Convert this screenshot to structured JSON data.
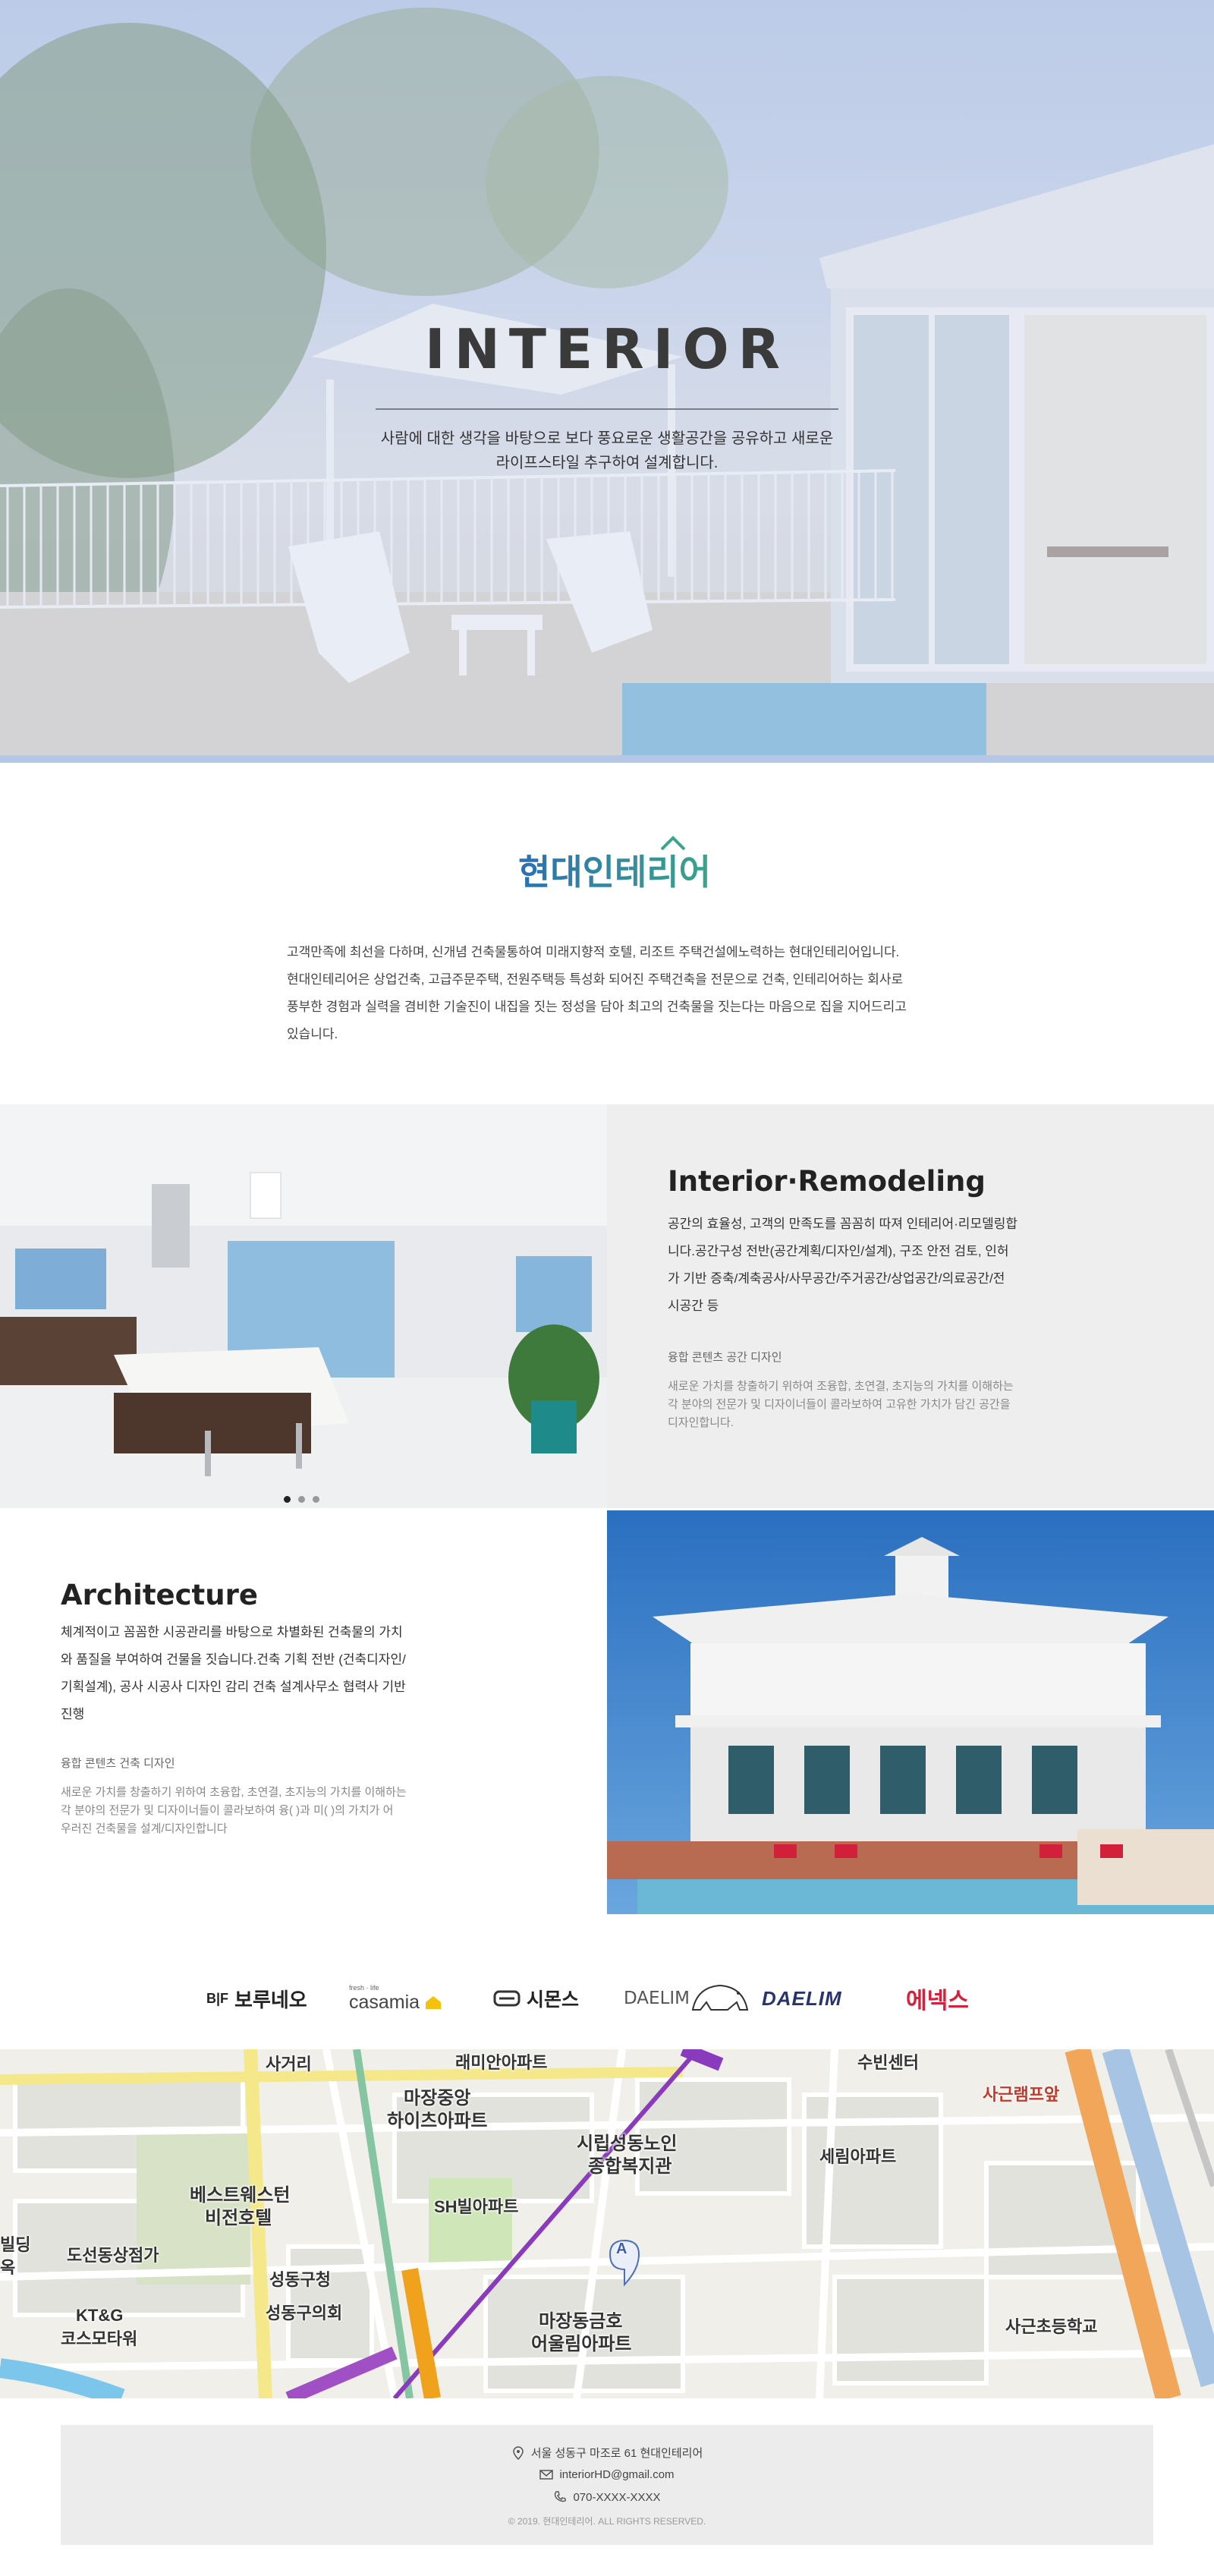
{
  "hero": {
    "title": "INTERIOR",
    "subtitle_line1": "사람에 대한 생각을 바탕으로 보다 풍요로운 생활공간을 공유하고 새로운",
    "subtitle_line2": "라이프스타일 추구하여 설계합니다."
  },
  "brand": {
    "logo_text": "현대인테리어",
    "accent_color": "#2a6fb5",
    "accent_color2": "#3aa58a"
  },
  "intro": {
    "lines": [
      "고객만족에 최선을 다하며, 신개념 건축물통하여 미래지향적 호텔, 리조트 주택건설에노력하는 현대인테리어입니다.",
      "현대인테리어은 상업건축, 고급주문주택, 전원주택등 특성화 되어진 주택건축을 전문으로 건축, 인테리어하는 회사로",
      "풍부한 경험과 실력을 겸비한 기술진이 내집을 짓는 정성을 담아 최고의 건축물을 짓는다는 마음으로 집을 지어드리고",
      "있습니다."
    ]
  },
  "interior_section": {
    "title": "Interior·Remodeling",
    "desc_lines": [
      "공간의 효율성, 고객의 만족도를 꼼꼼히 따져 인테리어·리모델링합",
      "니다.공간구성 전반(공간계획/디자인/설계), 구조 안전 검토, 인허",
      "가 기반 증축/계축공사/사무공간/주거공간/상업공간/의료공간/전",
      "시공간 등"
    ],
    "sub_title": "융합 콘텐츠 공간 디자인",
    "sub_lines": [
      "새로운 가치를 창출하기 위하여 조융합, 초연결, 초지능의 가치를 이해하는",
      "각 분야의 전문가 및 디자이너들이 콜라보하여 고유한 가치가 담긴 공간을",
      "디자인합니다."
    ]
  },
  "architecture_section": {
    "title": "Architecture",
    "desc_lines": [
      "체계적이고 꼼꼼한 시공관리를 바탕으로 차별화된 건축물의 가치",
      "와 품질을 부여하여 건물을 짓습니다.건축 기획 전반 (건축디자인/",
      "기획설계), 공사 시공사 디자인 감리 건축 설계사무소 협력사 기반",
      "진행"
    ],
    "sub_title": "융합 콘텐츠 건축 디자인",
    "sub_lines": [
      "새로운 가치를 창출하기 위하여 초융합, 초연결, 초지능의 가치를 이해하는",
      "각 분야의 전문가 및 디자이너들이 콜라보하여 융(    )과 미(    )의 가치가 어",
      "우러진 건축물을 설계/디자인합니다"
    ]
  },
  "partners": {
    "items": [
      {
        "name": "보루네오",
        "prefix": "B|F"
      },
      {
        "name": "casamia",
        "prefix": "fresh · life"
      },
      {
        "name": "시몬스"
      },
      {
        "name": "DAELIM",
        "style": "bear"
      },
      {
        "name": "DAELIM",
        "style": "bold"
      },
      {
        "name": "에넥스",
        "color": "#d6203c"
      }
    ]
  },
  "map": {
    "labels": [
      "사거리",
      "래미안아파트",
      "수빈센터",
      "사근램프앞",
      "마장중앙",
      "하이츠아파트",
      "시립성동노인",
      "종합복지관",
      "세림아파트",
      "베스트웨스턴",
      "비전호텔",
      "SH빌아파트",
      "도선동상점가",
      "빌딩",
      "옥",
      "성동구청",
      "성동구의회",
      "KT&G",
      "코스모타워",
      "마장동금호",
      "어울림아파트",
      "사근초등학교",
      "A"
    ]
  },
  "footer": {
    "address": "서울 성동구 마조로 61 현대인테리어",
    "email": "interiorHD@gmail.com",
    "phone": "070-XXXX-XXXX",
    "copyright": "© 2019. 현대인테리어. ALL RIGHTS RESERVED."
  }
}
